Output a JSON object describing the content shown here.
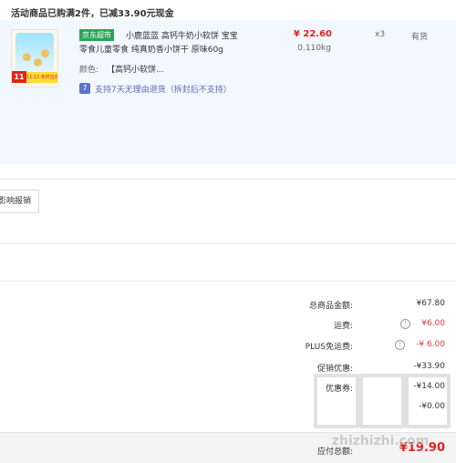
{
  "promo": {
    "text": "活动商品已购满2件，已减33.90元现金"
  },
  "product": {
    "image_badge": "11",
    "image_strip": "11.11 年终狂欢",
    "store_tag": "京东超市",
    "title_line1": "小鹿蓝蓝 高钙牛奶小软饼 宝宝",
    "title_line2": "零食儿童零食 纯真奶香小饼干 原味60g",
    "price": "¥ 22.60",
    "weight": "0.110kg",
    "quantity": "x3",
    "stock": "有货",
    "color_label": "颜色:",
    "color_value": "【高钙小软饼...",
    "return_icon": "7",
    "return_text": "支持7天无理由退货（拆封后不支持）"
  },
  "actions": {
    "report_label": "影响报销"
  },
  "summary": {
    "goods_total_label": "总商品金额:",
    "goods_total_value": "¥67.80",
    "shipping_label": "运费:",
    "shipping_value": "¥6.00",
    "plus_free_shipping_label": "PLUS免运费:",
    "plus_free_shipping_value": "-¥ 6.00",
    "promo_discount_label": "促销优惠:",
    "promo_discount_value": "-¥33.90",
    "coupon_label": "优惠券:",
    "coupon_value": "-¥14.00",
    "other_value": "-¥0.00"
  },
  "footer": {
    "payable_label": "应付总额:",
    "payable_value": "¥19.90"
  },
  "watermark": {
    "url": "zhizhizhi.com",
    "glyph": "值"
  },
  "colors": {
    "accent_red": "#e2231a",
    "jd_green": "#2aa55a",
    "product_bg": "#f2f8ff"
  }
}
